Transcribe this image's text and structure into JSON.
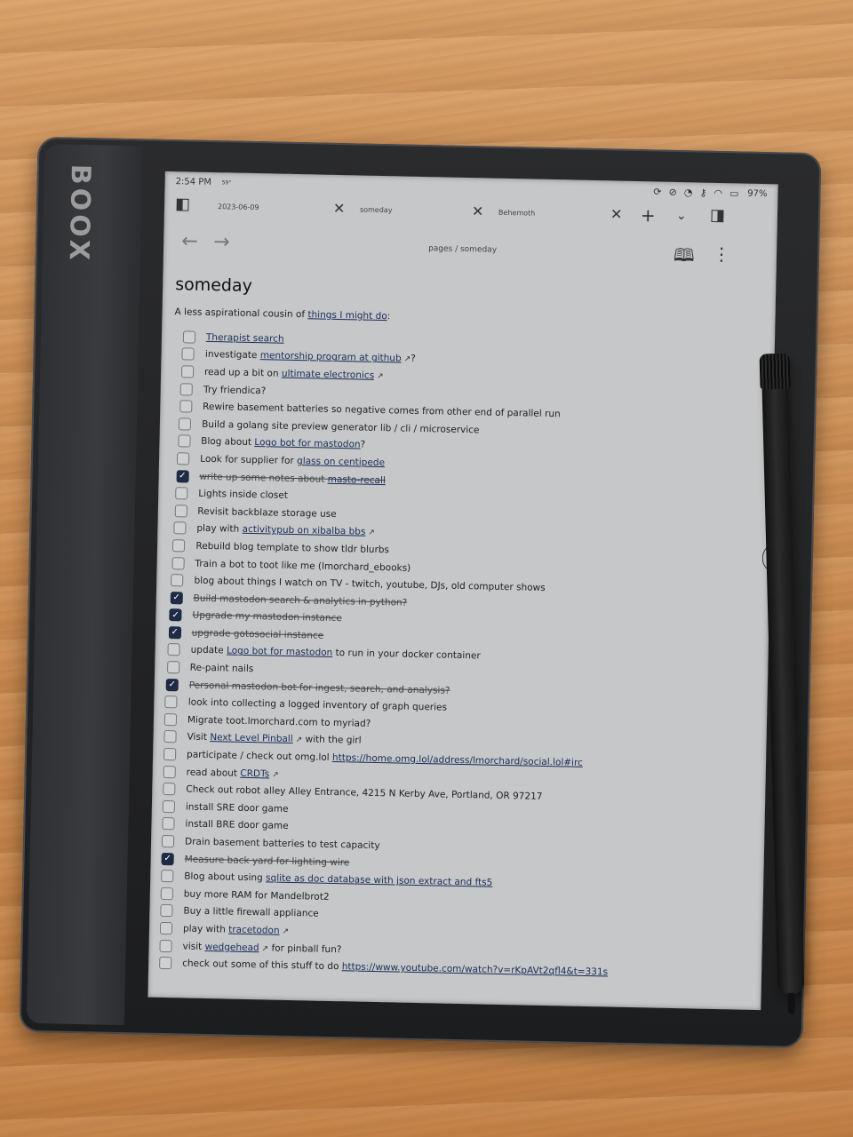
{
  "device": {
    "brand": "BOOX"
  },
  "status_bar": {
    "time": "2:54 PM",
    "temperature": "59°",
    "battery": "97%"
  },
  "tabs": [
    {
      "label": "2023-06-09"
    },
    {
      "label": "someday"
    },
    {
      "label": "Behemoth"
    }
  ],
  "breadcrumb": {
    "text": "pages  /  someday"
  },
  "page": {
    "title": "someday",
    "intro_text": "A less aspirational cousin of ",
    "intro_link": "things I might do",
    "intro_suffix": ":"
  },
  "tasks": [
    {
      "pre": "",
      "link": "Therapist search",
      "post": "",
      "ext": false,
      "done": false
    },
    {
      "pre": "investigate ",
      "link": "mentorship program at github",
      "post": "?",
      "ext": true,
      "done": false
    },
    {
      "pre": "read up a bit on ",
      "link": "ultimate electronics",
      "post": "",
      "ext": true,
      "done": false
    },
    {
      "pre": "Try friendica?",
      "link": "",
      "post": "",
      "ext": false,
      "done": false
    },
    {
      "pre": "Rewire basement batteries so negative comes from other end of parallel run",
      "link": "",
      "post": "",
      "ext": false,
      "done": false
    },
    {
      "pre": "Build a golang site preview generator lib / cli / microservice",
      "link": "",
      "post": "",
      "ext": false,
      "done": false
    },
    {
      "pre": "Blog about ",
      "link": "Logo bot for mastodon",
      "post": "?",
      "ext": false,
      "done": false
    },
    {
      "pre": "Look for supplier for ",
      "link": "glass on centipede",
      "post": "",
      "ext": false,
      "done": false
    },
    {
      "pre": "write up some notes about ",
      "link": "masto-recall",
      "post": "",
      "ext": false,
      "done": true
    },
    {
      "pre": "Lights inside closet",
      "link": "",
      "post": "",
      "ext": false,
      "done": false
    },
    {
      "pre": "Revisit backblaze storage use",
      "link": "",
      "post": "",
      "ext": false,
      "done": false
    },
    {
      "pre": "play with ",
      "link": "activitypub on xibalba bbs",
      "post": "",
      "ext": true,
      "done": false
    },
    {
      "pre": "Rebuild blog template to show tldr blurbs",
      "link": "",
      "post": "",
      "ext": false,
      "done": false
    },
    {
      "pre": "Train a bot to toot like me (lmorchard_ebooks)",
      "link": "",
      "post": "",
      "ext": false,
      "done": false
    },
    {
      "pre": "blog about things I watch on TV - twitch, youtube, DJs, old computer shows",
      "link": "",
      "post": "",
      "ext": false,
      "done": false
    },
    {
      "pre": "Build mastodon search & analytics in python?",
      "link": "",
      "post": "",
      "ext": false,
      "done": true
    },
    {
      "pre": "Upgrade my mastodon instance",
      "link": "",
      "post": "",
      "ext": false,
      "done": true
    },
    {
      "pre": "upgrade gotosocial instance",
      "link": "",
      "post": "",
      "ext": false,
      "done": true
    },
    {
      "pre": "update ",
      "link": "Logo bot for mastodon",
      "post": " to run in your docker container",
      "ext": false,
      "done": false
    },
    {
      "pre": "Re-paint nails",
      "link": "",
      "post": "",
      "ext": false,
      "done": false
    },
    {
      "pre": "Personal mastodon bot for ingest, search, and analysis?",
      "link": "",
      "post": "",
      "ext": false,
      "done": true
    },
    {
      "pre": "look into collecting a logged inventory of graph queries",
      "link": "",
      "post": "",
      "ext": false,
      "done": false
    },
    {
      "pre": "Migrate toot.lmorchard.com to myriad?",
      "link": "",
      "post": "",
      "ext": false,
      "done": false
    },
    {
      "pre": "Visit ",
      "link": "Next Level Pinball",
      "post": " with the girl",
      "ext": true,
      "done": false
    },
    {
      "pre": "participate / check out omg.lol ",
      "link": "https://home.omg.lol/address/lmorchard/social.lol#irc",
      "post": "",
      "ext": false,
      "done": false
    },
    {
      "pre": "read about ",
      "link": "CRDTs",
      "post": "",
      "ext": true,
      "done": false
    },
    {
      "pre": "Check out robot alley Alley Entrance, 4215 N Kerby Ave, Portland, OR 97217",
      "link": "",
      "post": "",
      "ext": false,
      "done": false
    },
    {
      "pre": "install SRE door game",
      "link": "",
      "post": "",
      "ext": false,
      "done": false
    },
    {
      "pre": "install BRE door game",
      "link": "",
      "post": "",
      "ext": false,
      "done": false
    },
    {
      "pre": "Drain basement batteries to test capacity",
      "link": "",
      "post": "",
      "ext": false,
      "done": false
    },
    {
      "pre": "Measure back yard for lighting wire",
      "link": "",
      "post": "",
      "ext": false,
      "done": true
    },
    {
      "pre": "Blog about using ",
      "link": "sqlite as doc database with json extract and fts5",
      "post": "",
      "ext": false,
      "done": false
    },
    {
      "pre": "buy more RAM for Mandelbrot2",
      "link": "",
      "post": "",
      "ext": false,
      "done": false
    },
    {
      "pre": "Buy a little firewall appliance",
      "link": "",
      "post": "",
      "ext": false,
      "done": false
    },
    {
      "pre": "play with ",
      "link": "tracetodon",
      "post": "",
      "ext": true,
      "done": false
    },
    {
      "pre": "visit ",
      "link": "wedgehead",
      "post": " for pinball fun?",
      "ext": true,
      "done": false
    },
    {
      "pre": "check out some of this stuff to do ",
      "link": "https://www.youtube.com/watch?v=rKpAVt2qfl4&t=331s",
      "post": "",
      "ext": false,
      "done": false
    }
  ],
  "icons": {
    "ext_glyph": "↗",
    "check_glyph": "✓"
  }
}
